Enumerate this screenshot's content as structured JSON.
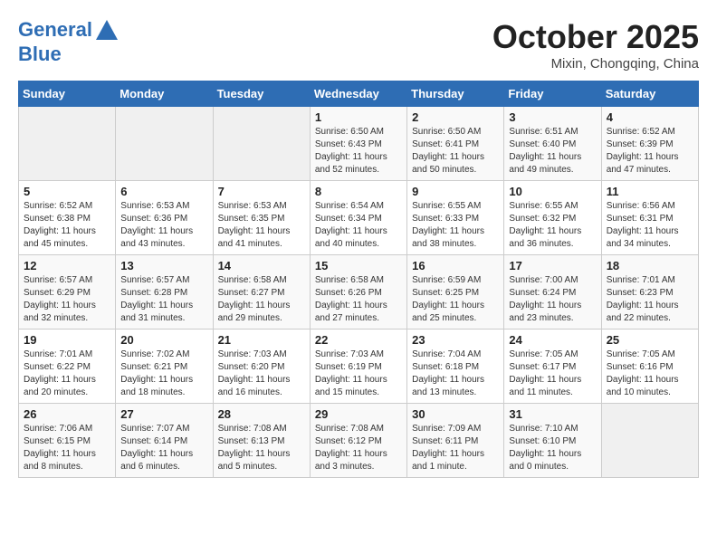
{
  "header": {
    "logo_line1": "General",
    "logo_line2": "Blue",
    "month": "October 2025",
    "location": "Mixin, Chongqing, China"
  },
  "weekdays": [
    "Sunday",
    "Monday",
    "Tuesday",
    "Wednesday",
    "Thursday",
    "Friday",
    "Saturday"
  ],
  "weeks": [
    [
      {
        "day": "",
        "empty": true
      },
      {
        "day": "",
        "empty": true
      },
      {
        "day": "",
        "empty": true
      },
      {
        "day": "1",
        "sunrise": "6:50 AM",
        "sunset": "6:43 PM",
        "daylight": "11 hours and 52 minutes."
      },
      {
        "day": "2",
        "sunrise": "6:50 AM",
        "sunset": "6:41 PM",
        "daylight": "11 hours and 50 minutes."
      },
      {
        "day": "3",
        "sunrise": "6:51 AM",
        "sunset": "6:40 PM",
        "daylight": "11 hours and 49 minutes."
      },
      {
        "day": "4",
        "sunrise": "6:52 AM",
        "sunset": "6:39 PM",
        "daylight": "11 hours and 47 minutes."
      }
    ],
    [
      {
        "day": "5",
        "sunrise": "6:52 AM",
        "sunset": "6:38 PM",
        "daylight": "11 hours and 45 minutes."
      },
      {
        "day": "6",
        "sunrise": "6:53 AM",
        "sunset": "6:36 PM",
        "daylight": "11 hours and 43 minutes."
      },
      {
        "day": "7",
        "sunrise": "6:53 AM",
        "sunset": "6:35 PM",
        "daylight": "11 hours and 41 minutes."
      },
      {
        "day": "8",
        "sunrise": "6:54 AM",
        "sunset": "6:34 PM",
        "daylight": "11 hours and 40 minutes."
      },
      {
        "day": "9",
        "sunrise": "6:55 AM",
        "sunset": "6:33 PM",
        "daylight": "11 hours and 38 minutes."
      },
      {
        "day": "10",
        "sunrise": "6:55 AM",
        "sunset": "6:32 PM",
        "daylight": "11 hours and 36 minutes."
      },
      {
        "day": "11",
        "sunrise": "6:56 AM",
        "sunset": "6:31 PM",
        "daylight": "11 hours and 34 minutes."
      }
    ],
    [
      {
        "day": "12",
        "sunrise": "6:57 AM",
        "sunset": "6:29 PM",
        "daylight": "11 hours and 32 minutes."
      },
      {
        "day": "13",
        "sunrise": "6:57 AM",
        "sunset": "6:28 PM",
        "daylight": "11 hours and 31 minutes."
      },
      {
        "day": "14",
        "sunrise": "6:58 AM",
        "sunset": "6:27 PM",
        "daylight": "11 hours and 29 minutes."
      },
      {
        "day": "15",
        "sunrise": "6:58 AM",
        "sunset": "6:26 PM",
        "daylight": "11 hours and 27 minutes."
      },
      {
        "day": "16",
        "sunrise": "6:59 AM",
        "sunset": "6:25 PM",
        "daylight": "11 hours and 25 minutes."
      },
      {
        "day": "17",
        "sunrise": "7:00 AM",
        "sunset": "6:24 PM",
        "daylight": "11 hours and 23 minutes."
      },
      {
        "day": "18",
        "sunrise": "7:01 AM",
        "sunset": "6:23 PM",
        "daylight": "11 hours and 22 minutes."
      }
    ],
    [
      {
        "day": "19",
        "sunrise": "7:01 AM",
        "sunset": "6:22 PM",
        "daylight": "11 hours and 20 minutes."
      },
      {
        "day": "20",
        "sunrise": "7:02 AM",
        "sunset": "6:21 PM",
        "daylight": "11 hours and 18 minutes."
      },
      {
        "day": "21",
        "sunrise": "7:03 AM",
        "sunset": "6:20 PM",
        "daylight": "11 hours and 16 minutes."
      },
      {
        "day": "22",
        "sunrise": "7:03 AM",
        "sunset": "6:19 PM",
        "daylight": "11 hours and 15 minutes."
      },
      {
        "day": "23",
        "sunrise": "7:04 AM",
        "sunset": "6:18 PM",
        "daylight": "11 hours and 13 minutes."
      },
      {
        "day": "24",
        "sunrise": "7:05 AM",
        "sunset": "6:17 PM",
        "daylight": "11 hours and 11 minutes."
      },
      {
        "day": "25",
        "sunrise": "7:05 AM",
        "sunset": "6:16 PM",
        "daylight": "11 hours and 10 minutes."
      }
    ],
    [
      {
        "day": "26",
        "sunrise": "7:06 AM",
        "sunset": "6:15 PM",
        "daylight": "11 hours and 8 minutes."
      },
      {
        "day": "27",
        "sunrise": "7:07 AM",
        "sunset": "6:14 PM",
        "daylight": "11 hours and 6 minutes."
      },
      {
        "day": "28",
        "sunrise": "7:08 AM",
        "sunset": "6:13 PM",
        "daylight": "11 hours and 5 minutes."
      },
      {
        "day": "29",
        "sunrise": "7:08 AM",
        "sunset": "6:12 PM",
        "daylight": "11 hours and 3 minutes."
      },
      {
        "day": "30",
        "sunrise": "7:09 AM",
        "sunset": "6:11 PM",
        "daylight": "11 hours and 1 minute."
      },
      {
        "day": "31",
        "sunrise": "7:10 AM",
        "sunset": "6:10 PM",
        "daylight": "11 hours and 0 minutes."
      },
      {
        "day": "",
        "empty": true
      }
    ]
  ]
}
